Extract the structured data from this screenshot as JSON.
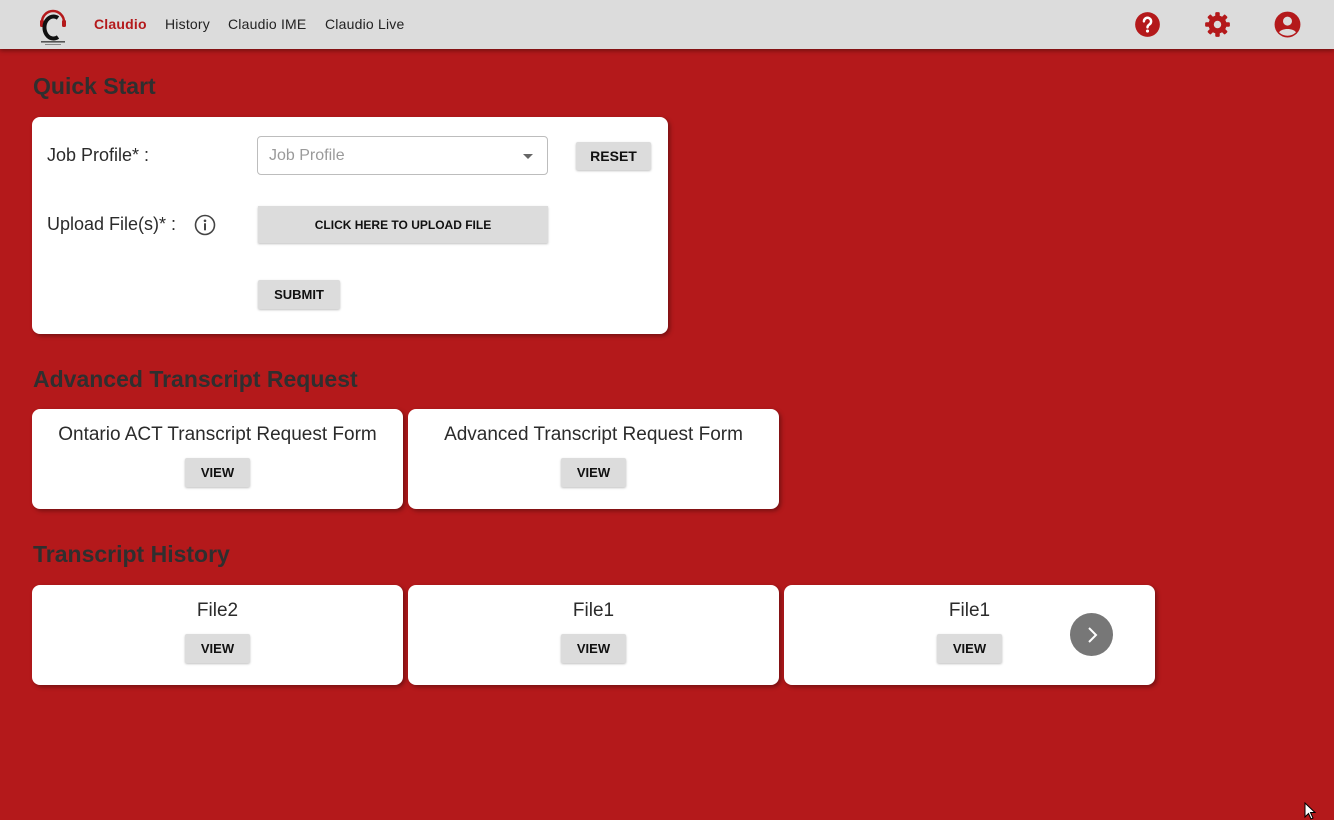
{
  "nav": {
    "items": [
      "Claudio",
      "History",
      "Claudio IME",
      "Claudio Live"
    ],
    "active": "Claudio",
    "icons": [
      "help-icon",
      "settings-icon",
      "account-icon"
    ]
  },
  "quick_start": {
    "title": "Quick Start",
    "job_profile_label": "Job Profile* :",
    "job_profile_placeholder": "Job Profile",
    "reset_label": "RESET",
    "upload_label": "Upload File(s)* :",
    "upload_button": "CLICK HERE TO UPLOAD FILE",
    "submit_label": "SUBMIT"
  },
  "advanced": {
    "title": "Advanced Transcript Request",
    "cards": [
      {
        "title": "Ontario ACT Transcript Request Form",
        "button": "VIEW"
      },
      {
        "title": "Advanced Transcript Request Form",
        "button": "VIEW"
      }
    ]
  },
  "history": {
    "title": "Transcript History",
    "cards": [
      {
        "title": "File2",
        "button": "VIEW"
      },
      {
        "title": "File1",
        "button": "VIEW"
      },
      {
        "title": "File1",
        "button": "VIEW"
      }
    ]
  },
  "colors": {
    "brand_red": "#b4191b",
    "topbar": "#dcdcdc",
    "button": "#dcdcdc"
  }
}
